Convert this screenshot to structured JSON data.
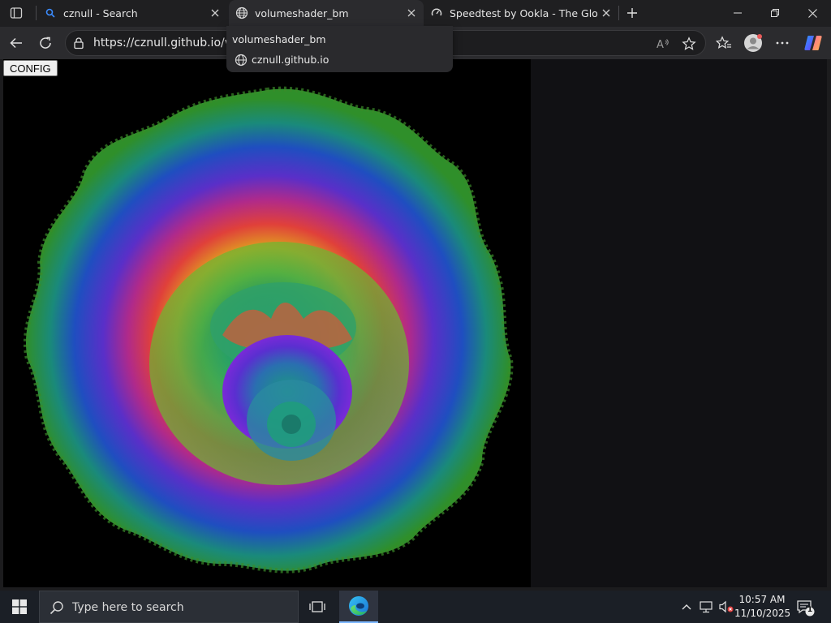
{
  "tabs": [
    {
      "title": "cznull - Search",
      "active": false
    },
    {
      "title": "volumeshader_bm",
      "active": true
    },
    {
      "title": "Speedtest by Ookla - The Global Broadband Speed Test",
      "active": false
    }
  ],
  "address": {
    "url": "https://cznull.github.io/vsbm"
  },
  "hovercard": {
    "title": "volumeshader_bm",
    "domain": "cznull.github.io"
  },
  "page": {
    "config_label": "CONFIG"
  },
  "taskbar": {
    "search_placeholder": "Type here to search",
    "time": "10:57 AM",
    "date": "11/10/2025",
    "notification_count": "1"
  },
  "colors": {
    "accent": "#7db7ff",
    "tab_active": "#2b2b2e",
    "taskbar": "#1b1f26"
  }
}
